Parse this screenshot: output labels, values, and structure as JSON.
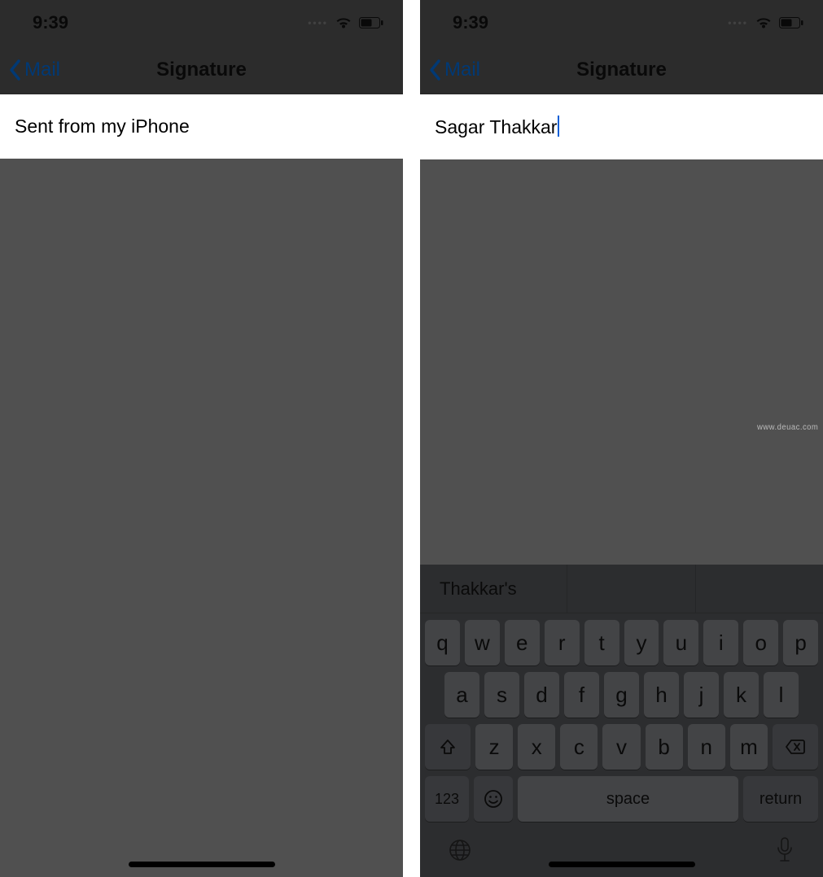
{
  "watermark": "www.deuac.com",
  "left": {
    "time": "9:39",
    "back_label": "Mail",
    "title": "Signature",
    "signature_text": "Sent from my iPhone"
  },
  "right": {
    "time": "9:39",
    "back_label": "Mail",
    "title": "Signature",
    "signature_text": "Sagar Thakkar",
    "suggestions": {
      "first": "Thakkar's",
      "second": "",
      "third": ""
    },
    "keys": {
      "row1": [
        "q",
        "w",
        "e",
        "r",
        "t",
        "y",
        "u",
        "i",
        "o",
        "p"
      ],
      "row2": [
        "a",
        "s",
        "d",
        "f",
        "g",
        "h",
        "j",
        "k",
        "l"
      ],
      "row3": [
        "z",
        "x",
        "c",
        "v",
        "b",
        "n",
        "m"
      ],
      "num": "123",
      "space": "space",
      "return": "return"
    }
  }
}
